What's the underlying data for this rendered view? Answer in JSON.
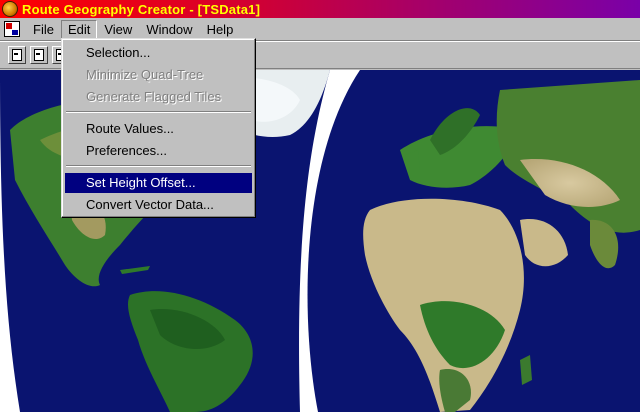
{
  "window": {
    "title": "Route Geography Creator - [TSData1]"
  },
  "menubar": {
    "items": [
      {
        "label": "File"
      },
      {
        "label": "Edit"
      },
      {
        "label": "View"
      },
      {
        "label": "Window"
      },
      {
        "label": "Help"
      }
    ]
  },
  "edit_menu": {
    "items": [
      {
        "label": "Selection...",
        "enabled": true
      },
      {
        "label": "Minimize Quad-Tree",
        "enabled": false
      },
      {
        "label": "Generate Flagged Tiles",
        "enabled": false
      },
      {
        "label": "Route Values...",
        "enabled": true
      },
      {
        "label": "Preferences...",
        "enabled": true
      },
      {
        "label": "Set Height Offset...",
        "enabled": true,
        "highlighted": true
      },
      {
        "label": "Convert Vector Data...",
        "enabled": true
      }
    ]
  },
  "colors": {
    "ocean": "#0a1470",
    "land": "#2f7a2a",
    "desert": "#c9b98a",
    "highlight": "#000080"
  }
}
